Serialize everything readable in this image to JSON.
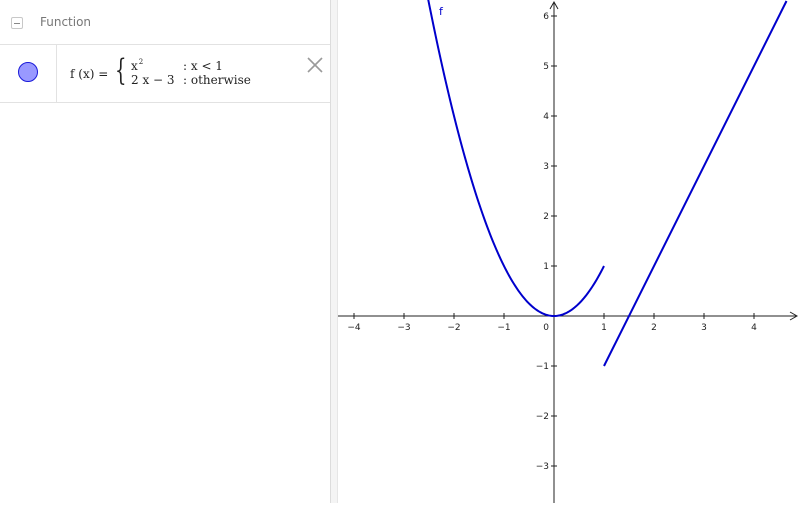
{
  "algebra": {
    "group_title": "Function",
    "item": {
      "label": "f (x)  =",
      "case1_expr": "x",
      "case1_sup": "2",
      "case1_cond": ": x < 1",
      "case2_expr": "2 x − 3",
      "case2_cond": ": otherwise",
      "color": "#0000cc"
    }
  },
  "graphics": {
    "function_label": "f",
    "curve_color": "#0000cc",
    "x_ticks": [
      {
        "v": -4,
        "label": "−4"
      },
      {
        "v": -3,
        "label": "−3"
      },
      {
        "v": -2,
        "label": "−2"
      },
      {
        "v": -1,
        "label": "−1"
      },
      {
        "v": 1,
        "label": "1"
      },
      {
        "v": 2,
        "label": "2"
      },
      {
        "v": 3,
        "label": "3"
      },
      {
        "v": 4,
        "label": "4"
      }
    ],
    "y_ticks": [
      {
        "v": -3,
        "label": "−3"
      },
      {
        "v": -2,
        "label": "−2"
      },
      {
        "v": -1,
        "label": "−1"
      },
      {
        "v": 1,
        "label": "1"
      },
      {
        "v": 2,
        "label": "2"
      },
      {
        "v": 3,
        "label": "3"
      },
      {
        "v": 4,
        "label": "4"
      },
      {
        "v": 5,
        "label": "5"
      },
      {
        "v": 6,
        "label": "6"
      }
    ],
    "origin_label": "0"
  }
}
